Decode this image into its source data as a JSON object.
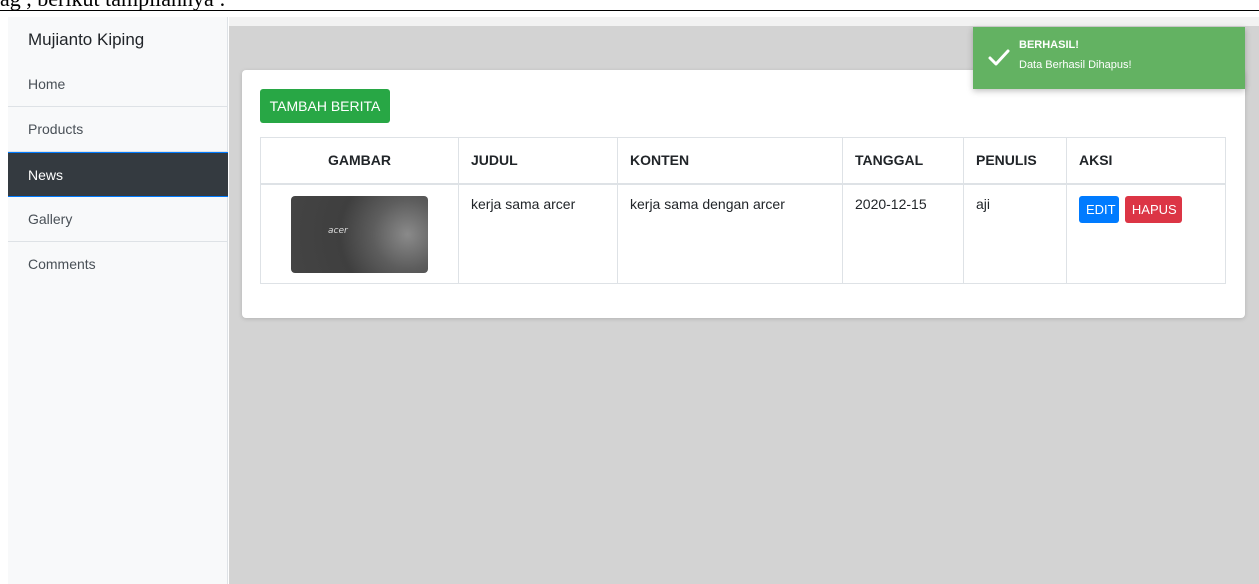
{
  "doc_text": "ag , berikut tampilannya :",
  "sidebar": {
    "brand": "Mujianto Kiping",
    "items": [
      {
        "label": "Home",
        "active": false
      },
      {
        "label": "Products",
        "active": false
      },
      {
        "label": "News",
        "active": true
      },
      {
        "label": "Gallery",
        "active": false
      },
      {
        "label": "Comments",
        "active": false
      }
    ]
  },
  "main": {
    "add_button": "TAMBAH BERITA",
    "table": {
      "headers": [
        "GAMBAR",
        "JUDUL",
        "KONTEN",
        "TANGGAL",
        "PENULIS",
        "AKSI"
      ],
      "rows": [
        {
          "image_logo": "acer",
          "judul": "kerja sama arcer",
          "konten": "kerja sama dengan arcer",
          "tanggal": "2020-12-15",
          "penulis": "aji",
          "edit_label": "EDIT",
          "hapus_label": "HAPUS"
        }
      ]
    }
  },
  "toast": {
    "icon": "check-icon",
    "title": "BERHASIL!",
    "message": "Data Berhasil Dihapus!",
    "color": "#63b262"
  },
  "colors": {
    "sidebar_active": "#343a40",
    "add_button": "#28a745",
    "edit_button": "#007bff",
    "hapus_button": "#dc3545"
  }
}
